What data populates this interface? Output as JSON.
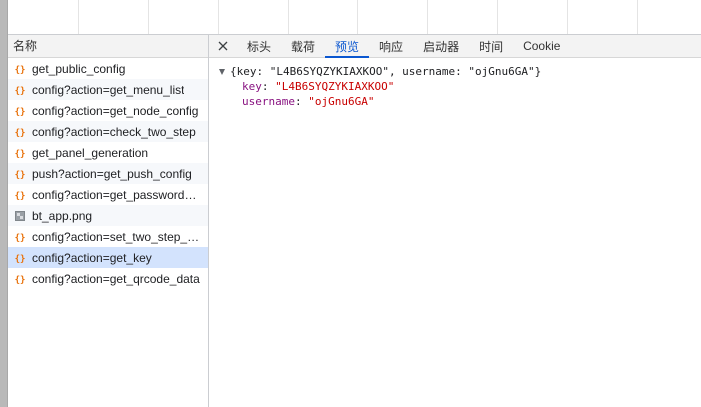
{
  "colors": {
    "accent": "#0b57d0",
    "selected_row": "#d3e3fd",
    "json_icon": "#e8710a",
    "key_color": "#881280",
    "string_color": "#c80000"
  },
  "name_column": {
    "header": "名称",
    "requests": [
      {
        "name": "get_public_config",
        "icon": "json-icon",
        "selected": false
      },
      {
        "name": "config?action=get_menu_list",
        "icon": "json-icon",
        "selected": false
      },
      {
        "name": "config?action=get_node_config",
        "icon": "json-icon",
        "selected": false
      },
      {
        "name": "config?action=check_two_step",
        "icon": "json-icon",
        "selected": false
      },
      {
        "name": "get_panel_generation",
        "icon": "json-icon",
        "selected": false
      },
      {
        "name": "push?action=get_push_config",
        "icon": "json-icon",
        "selected": false
      },
      {
        "name": "config?action=get_password…",
        "icon": "json-icon",
        "selected": false
      },
      {
        "name": "bt_app.png",
        "icon": "image-icon",
        "selected": false
      },
      {
        "name": "config?action=set_two_step_…",
        "icon": "json-icon",
        "selected": false
      },
      {
        "name": "config?action=get_key",
        "icon": "json-icon",
        "selected": true
      },
      {
        "name": "config?action=get_qrcode_data",
        "icon": "json-icon",
        "selected": false
      }
    ]
  },
  "detail": {
    "tabs": [
      {
        "label": "标头",
        "active": false
      },
      {
        "label": "载荷",
        "active": false
      },
      {
        "label": "预览",
        "active": true
      },
      {
        "label": "响应",
        "active": false
      },
      {
        "label": "启动器",
        "active": false
      },
      {
        "label": "时间",
        "active": false
      },
      {
        "label": "Cookie",
        "active": false
      }
    ],
    "preview": {
      "summary": "{key: \"L4B6SYQZYKIAXKOO\", username: \"ojGnu6GA\"}",
      "properties": [
        {
          "key": "key",
          "value": "\"L4B6SYQZYKIAXKOO\""
        },
        {
          "key": "username",
          "value": "\"ojGnu6GA\""
        }
      ]
    }
  }
}
